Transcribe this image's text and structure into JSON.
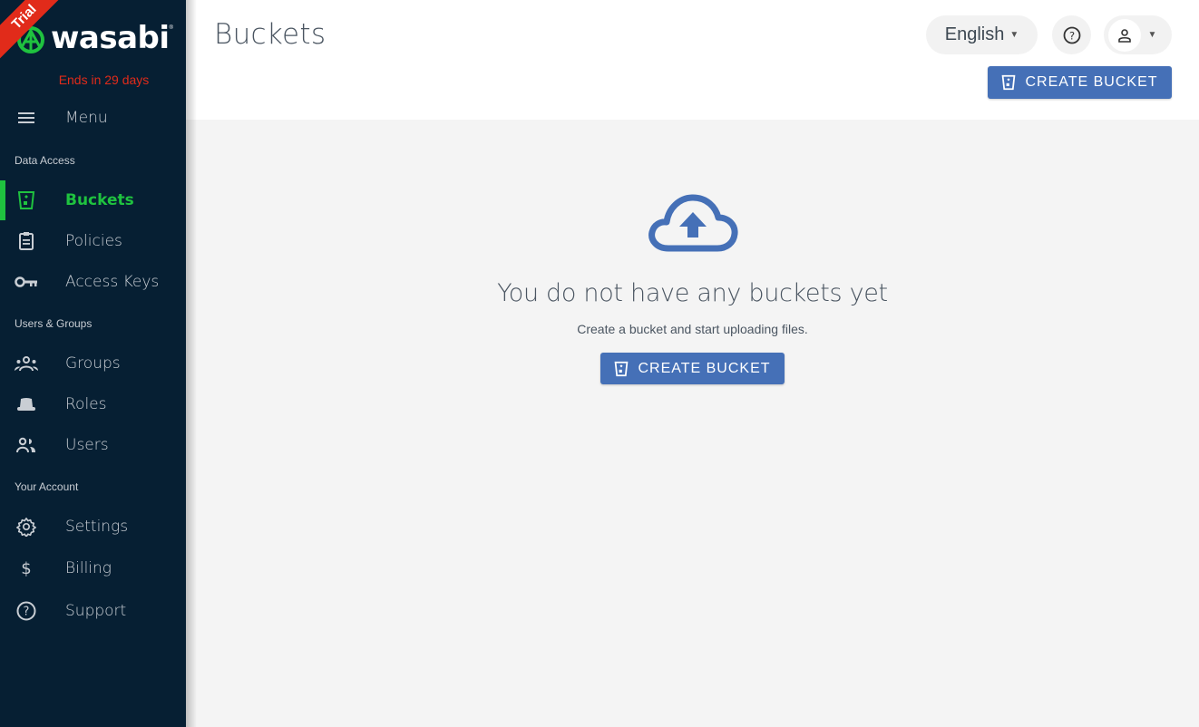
{
  "sidebar": {
    "trial_badge": "Trial",
    "brand": "wasabi",
    "trial_ends": "Ends in 29 days",
    "menu_label": "Menu",
    "sections": {
      "data_access": "Data Access",
      "users_groups": "Users & Groups",
      "your_account": "Your Account"
    },
    "items": [
      {
        "label": "Buckets",
        "icon": "bucket-icon",
        "active": true
      },
      {
        "label": "Policies",
        "icon": "clipboard-icon"
      },
      {
        "label": "Access Keys",
        "icon": "key-icon"
      },
      {
        "label": "Groups",
        "icon": "groups-icon"
      },
      {
        "label": "Roles",
        "icon": "hat-icon"
      },
      {
        "label": "Users",
        "icon": "users-icon"
      },
      {
        "label": "Settings",
        "icon": "gear-icon"
      },
      {
        "label": "Billing",
        "icon": "dollar-icon"
      },
      {
        "label": "Support",
        "icon": "help-circle-icon"
      }
    ]
  },
  "header": {
    "title": "Buckets",
    "language": "English",
    "create_bucket_label": "CREATE BUCKET"
  },
  "empty_state": {
    "title": "You do not have any buckets yet",
    "subtitle": "Create a bucket and start uploading files.",
    "button_label": "CREATE BUCKET"
  },
  "colors": {
    "sidebar_bg": "#061f33",
    "accent_green": "#1fc23f",
    "primary_blue": "#4570b7",
    "trial_red": "#e12b1a"
  }
}
